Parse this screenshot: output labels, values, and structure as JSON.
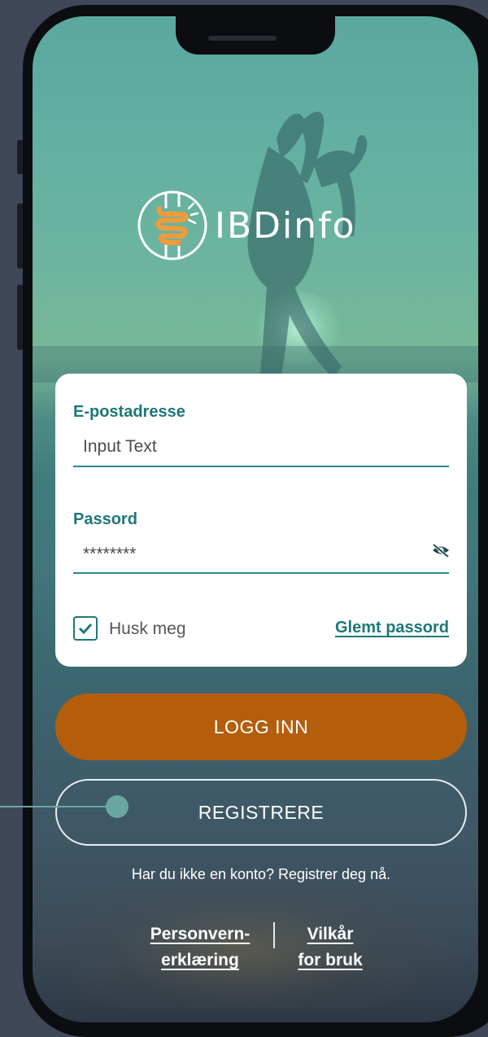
{
  "app": {
    "logo_text": "IBDinfo"
  },
  "login_form": {
    "email_label": "E-postadresse",
    "email_value": "Input Text",
    "password_label": "Passord",
    "password_value": "********",
    "remember_label": "Husk meg",
    "remember_checked": true,
    "forgot_link": "Glemt passord"
  },
  "actions": {
    "login_button": "LOGG INN",
    "register_button": "REGISTRERE",
    "register_prompt": "Har du ikke en konto? Registrer deg nå."
  },
  "footer": {
    "privacy_line1": "Personvern-",
    "privacy_line2": "erklæring",
    "terms_line1": "Vilkår",
    "terms_line2": "for bruk"
  },
  "colors": {
    "accent_teal": "#1e7778",
    "login_orange": "#b45e0c",
    "logo_orange": "#f29a3a"
  },
  "icons": {
    "password_toggle": "eye-off-icon",
    "checkbox": "checkmark-icon",
    "logo": "intestine-logo-icon"
  }
}
